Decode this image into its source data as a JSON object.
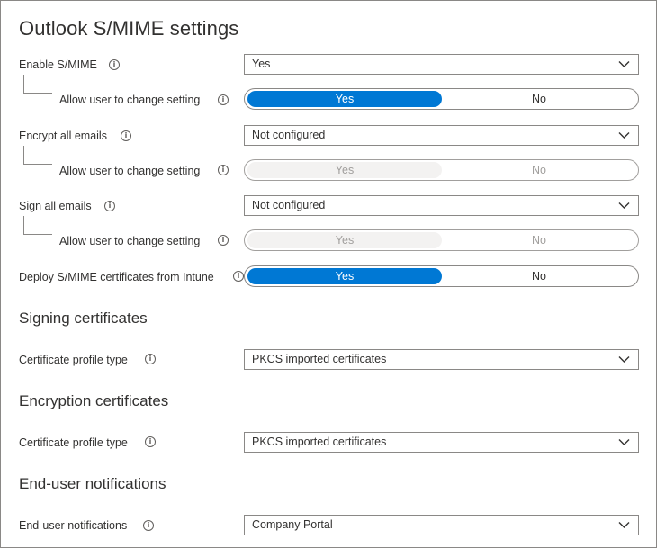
{
  "title": "Outlook S/MIME settings",
  "rows": {
    "enable_smime": {
      "label": "Enable S/MIME",
      "value": "Yes"
    },
    "enable_allow": {
      "label": "Allow user to change setting",
      "yes": "Yes",
      "no": "No",
      "selected": "Yes",
      "disabled": false
    },
    "encrypt_all": {
      "label": "Encrypt all emails",
      "value": "Not configured"
    },
    "encrypt_allow": {
      "label": "Allow user to change setting",
      "yes": "Yes",
      "no": "No",
      "selected": "",
      "disabled": true
    },
    "sign_all": {
      "label": "Sign all emails",
      "value": "Not configured"
    },
    "sign_allow": {
      "label": "Allow user to change setting",
      "yes": "Yes",
      "no": "No",
      "selected": "",
      "disabled": true
    },
    "deploy": {
      "label": "Deploy S/MIME certificates from Intune",
      "yes": "Yes",
      "no": "No",
      "selected": "Yes",
      "disabled": false
    }
  },
  "signing": {
    "heading": "Signing certificates",
    "profile_label": "Certificate profile type",
    "profile_value": "PKCS imported certificates"
  },
  "encryption": {
    "heading": "Encryption certificates",
    "profile_label": "Certificate profile type",
    "profile_value": "PKCS imported certificates"
  },
  "notifications": {
    "heading": "End-user notifications",
    "label": "End-user notifications",
    "value": "Company Portal"
  },
  "icons": {
    "info": "info-icon",
    "dropdown": "chevron-down-icon"
  },
  "info_glyph": "i",
  "colors": {
    "accent": "#0078d4",
    "border": "#8a8886",
    "disabled": "#a19f9d",
    "text": "#323130"
  }
}
